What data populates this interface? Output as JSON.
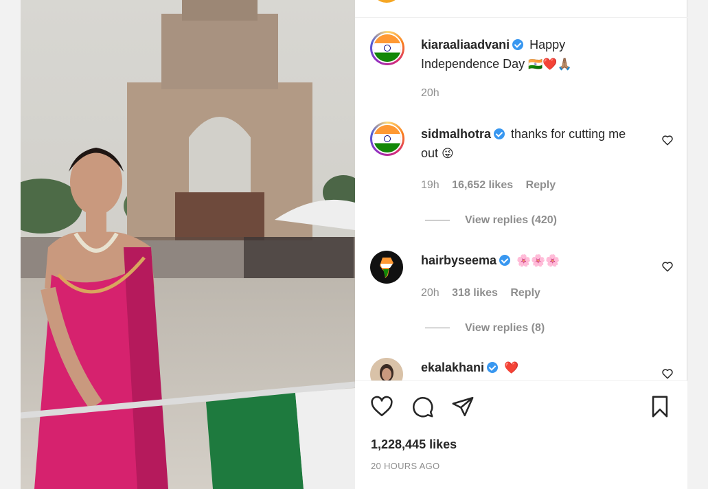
{
  "post": {
    "likes": "1,228,445 likes",
    "time_ago": "20 HOURS AGO"
  },
  "comments": [
    {
      "username": "kiaraaliaadvani",
      "verified": true,
      "text": "Happy Independence Day",
      "emoji": "🇮🇳❤️🙏🏽",
      "time": "20h",
      "avatar": "india-flag"
    },
    {
      "username": "sidmalhotra",
      "verified": true,
      "text": "thanks for cutting me out",
      "emoji": "😜",
      "time": "19h",
      "likes": "16,652 likes",
      "reply": "Reply",
      "view_replies": "View replies (420)",
      "avatar": "india-flag"
    },
    {
      "username": "hairbyseema",
      "verified": true,
      "text": "",
      "emoji": "🌸🌸🌸",
      "time": "20h",
      "likes": "318 likes",
      "reply": "Reply",
      "view_replies": "View replies (8)",
      "avatar": "india-map"
    },
    {
      "username": "ekalakhani",
      "verified": true,
      "text": "",
      "emoji": "❤️",
      "avatar": "portrait"
    }
  ],
  "icons": {
    "like": "heart-icon",
    "comment": "comment-icon",
    "share": "send-icon",
    "save": "bookmark-icon",
    "comment_like": "heart-icon"
  }
}
